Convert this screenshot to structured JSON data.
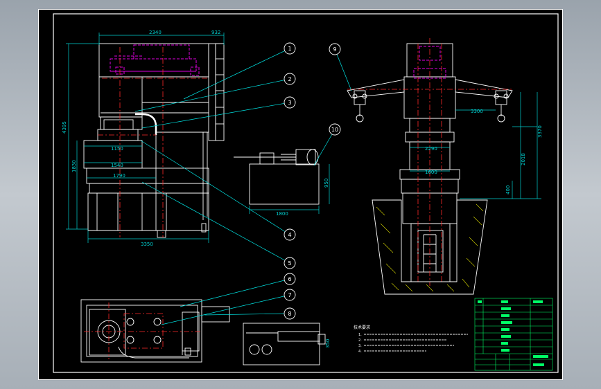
{
  "colors": {
    "outline": "#ffffff",
    "dimension": "#00d2d2",
    "centerline": "#ff2a2a",
    "detail": "#e000e0",
    "ground": "#d4d400",
    "leader": "#00e5e5",
    "title_table": "#00ff66",
    "background": "#000000"
  },
  "front_view": {
    "dims": {
      "top_width": "2340",
      "top_right": "932",
      "total_height": "4395",
      "base_width": "3350",
      "mid_height": "1830",
      "w1": "1150",
      "w2": "1540",
      "w3": "1790"
    }
  },
  "side_view": {
    "dims": {
      "beam_inner": "3300",
      "w1": "2290",
      "w2": "1600",
      "h_total": "3370",
      "h_upper": "2018",
      "h_low": "400"
    }
  },
  "motor_view": {
    "dims": {
      "width": "1800",
      "height": "950"
    }
  },
  "plan_view": {
    "dims": {
      "height": "350"
    }
  },
  "balloons": [
    "1",
    "2",
    "3",
    "4",
    "5",
    "6",
    "7",
    "8",
    "9",
    "10"
  ],
  "notes": {
    "title": "技术要求",
    "lines": [
      "1.",
      "2.",
      "3.",
      "4."
    ]
  }
}
